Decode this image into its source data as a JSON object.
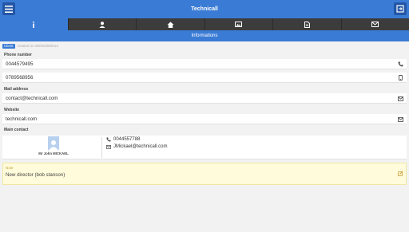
{
  "app": {
    "title": "Technicall"
  },
  "tabs": [
    {
      "icon": "info-icon",
      "active": true
    },
    {
      "icon": "user-icon",
      "active": false
    },
    {
      "icon": "home-icon",
      "active": false
    },
    {
      "icon": "image-icon",
      "active": false
    },
    {
      "icon": "document-icon",
      "active": false
    },
    {
      "icon": "mail-icon",
      "active": false
    }
  ],
  "section_title": "Informations",
  "meta": {
    "badge": "Client",
    "created": "created on 05/02/28/2014"
  },
  "phone": {
    "label": "Phone number",
    "values": [
      "0044579495",
      "0789568956"
    ]
  },
  "mail": {
    "label": "Mail address",
    "value": "contact@technicall.com"
  },
  "website": {
    "label": "Website",
    "value": "technicall.com"
  },
  "main_contact": {
    "label": "Main contact",
    "name": "Mr John MICKAEL",
    "phone": "0044557788",
    "email": "JMickael@technicall.com"
  },
  "note": {
    "label": "Note",
    "text": "New director (bob stanson)"
  },
  "colors": {
    "accent": "#3a7bd5",
    "tabbar": "#3c3c3c",
    "note_bg": "#fffbdb"
  }
}
